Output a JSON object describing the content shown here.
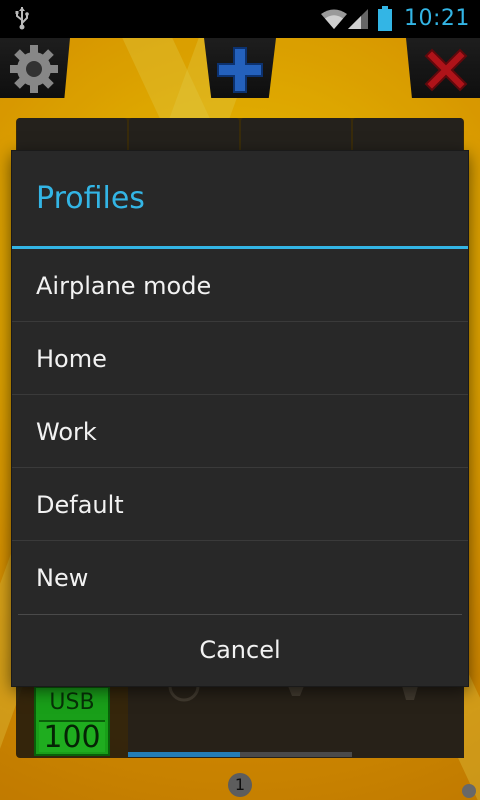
{
  "status_bar": {
    "time": "10:21",
    "icons": [
      "usb-icon",
      "wifi-icon",
      "signal-icon",
      "battery-icon"
    ],
    "accent_color": "#33b5e5"
  },
  "action_bar": {
    "icons": [
      "gear-icon",
      "plus-icon",
      "close-icon"
    ]
  },
  "widget": {
    "usb_label": "USB",
    "usb_value": "100",
    "page_number": "1"
  },
  "dialog": {
    "title": "Profiles",
    "items": [
      {
        "label": "Airplane mode"
      },
      {
        "label": "Home"
      },
      {
        "label": "Work"
      },
      {
        "label": "Default"
      },
      {
        "label": "New"
      }
    ],
    "cancel_label": "Cancel",
    "accent_color": "#33b5e5"
  }
}
